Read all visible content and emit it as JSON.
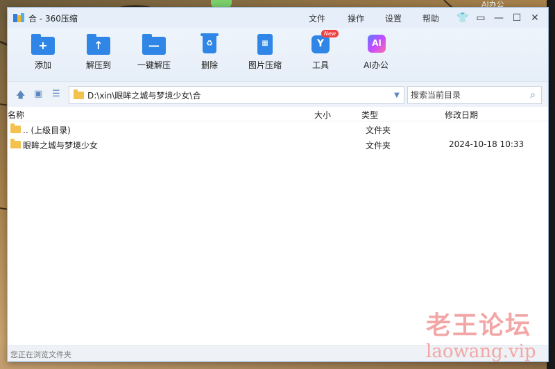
{
  "desktop": {
    "top_label": "AI办公"
  },
  "window": {
    "title": "合 - 360压缩",
    "menu": [
      "文件",
      "操作",
      "设置",
      "帮助"
    ]
  },
  "toolbar": {
    "items": [
      {
        "label": "添加",
        "icon": "add-folder-icon",
        "glyph": "+"
      },
      {
        "label": "解压到",
        "icon": "extract-to-icon",
        "glyph": "↑"
      },
      {
        "label": "一键解压",
        "icon": "one-click-extract-icon",
        "glyph": "—"
      },
      {
        "label": "删除",
        "icon": "trash-icon",
        "glyph": "♻"
      },
      {
        "label": "图片压缩",
        "icon": "image-compress-icon",
        "glyph": "▦"
      },
      {
        "label": "工具",
        "icon": "tools-icon",
        "glyph": "Y",
        "badge": "New"
      },
      {
        "label": "AI办公",
        "icon": "ai-office-icon",
        "glyph": "AI"
      }
    ]
  },
  "address": {
    "path": "D:\\xin\\眼眸之城与梦境少女\\合"
  },
  "search": {
    "placeholder": "搜索当前目录"
  },
  "columns": {
    "name": "名称",
    "size": "大小",
    "type": "类型",
    "modified": "修改日期"
  },
  "rows": [
    {
      "name": ".. (上级目录)",
      "size": "",
      "type": "文件夹",
      "modified": ""
    },
    {
      "name": "眼眸之城与梦境少女",
      "size": "",
      "type": "文件夹",
      "modified": "2024-10-18 10:33"
    }
  ],
  "status": "您正在浏览文件夹",
  "watermark": {
    "line1": "老王论坛",
    "line2": "laowang.vip"
  }
}
